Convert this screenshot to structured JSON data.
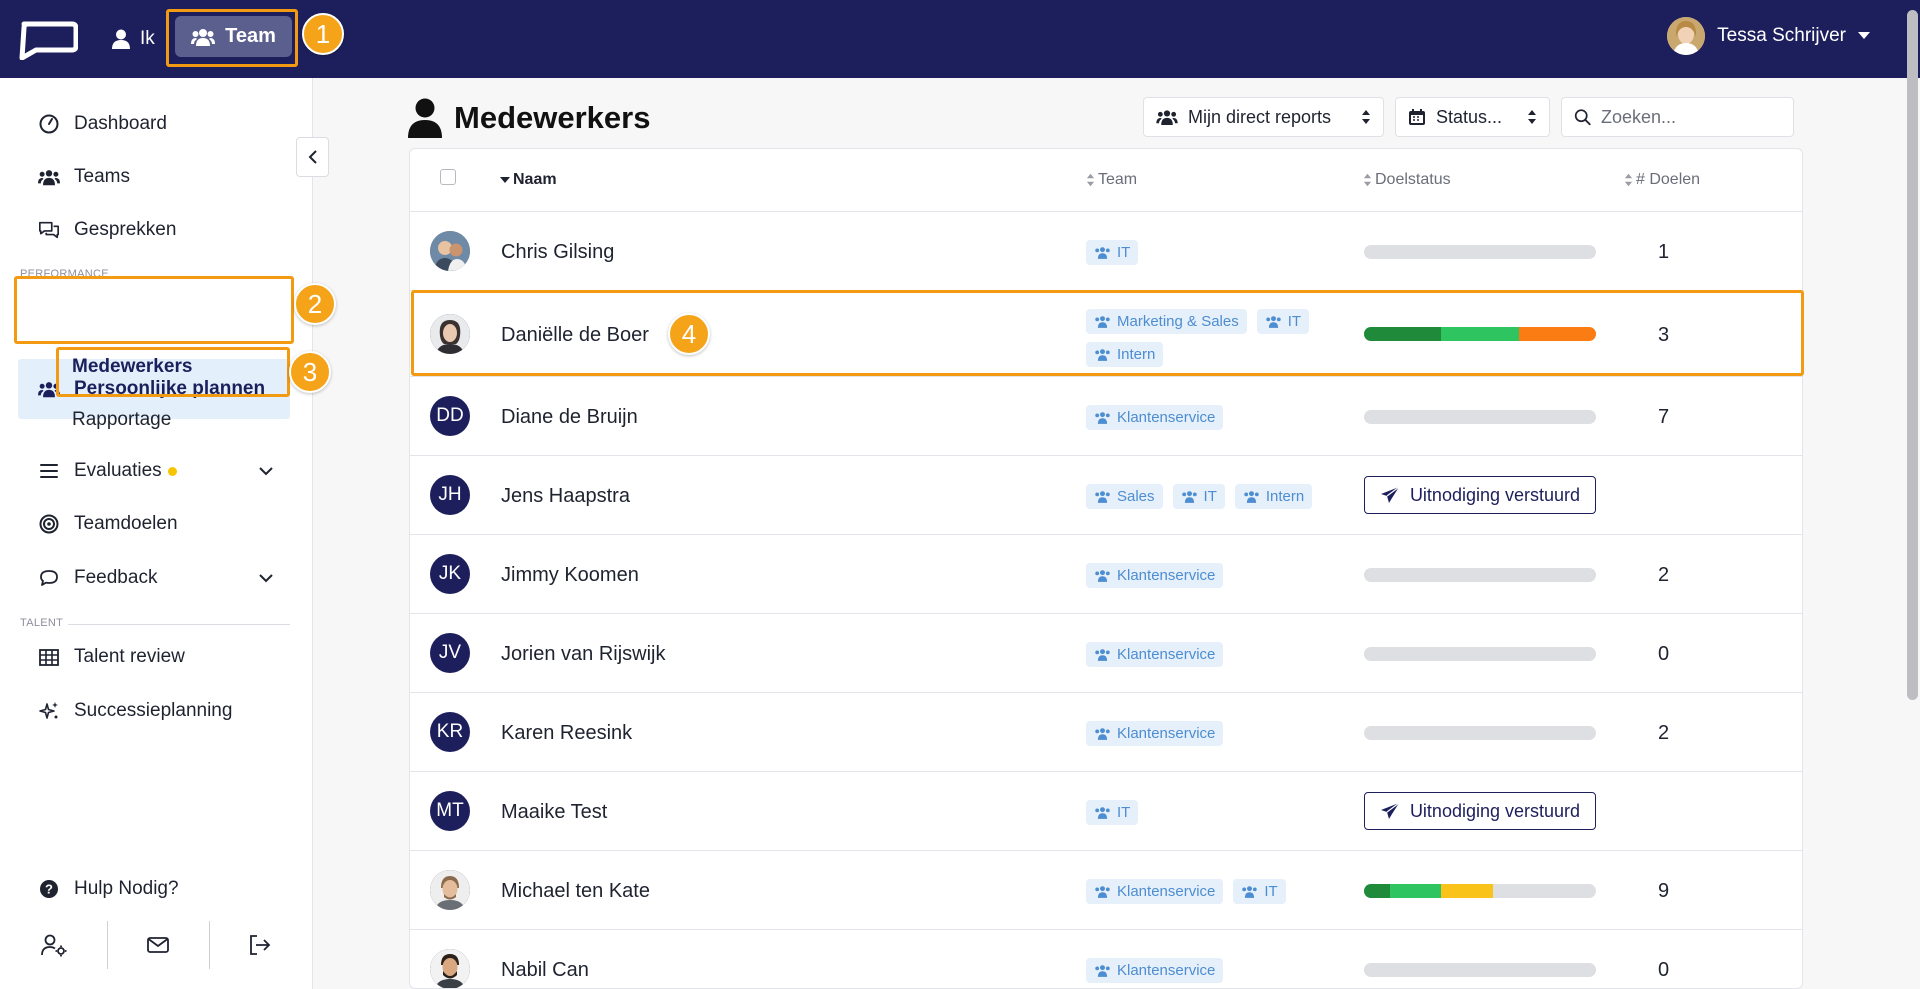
{
  "topbar": {
    "nav_ik": "Ik",
    "nav_team": "Team",
    "user_name": "Tessa Schrijver"
  },
  "sidebar": {
    "dashboard": "Dashboard",
    "teams": "Teams",
    "gesprekken": "Gesprekken",
    "section_performance": "PERFORMANCE",
    "persoonlijke_plannen": "Persoonlijke plannen",
    "sub_medewerkers": "Medewerkers",
    "sub_rapportage": "Rapportage",
    "evaluaties": "Evaluaties",
    "teamdoelen": "Teamdoelen",
    "feedback": "Feedback",
    "section_talent": "TALENT",
    "talent_review": "Talent review",
    "successieplanning": "Successieplanning",
    "hulp": "Hulp Nodig?"
  },
  "main": {
    "title": "Medewerkers",
    "filter_reports": "Mijn direct reports",
    "filter_status": "Status...",
    "search_placeholder": "Zoeken..."
  },
  "table": {
    "headers": {
      "naam": "Naam",
      "team": "Team",
      "doelstatus": "Doelstatus",
      "doelen": "# Doelen"
    },
    "rows": [
      {
        "name": "Chris Gilsing",
        "initials": "",
        "photo": true,
        "tags": [
          "IT"
        ],
        "count": "1"
      },
      {
        "name": "Daniëlle de Boer",
        "initials": "",
        "photo": true,
        "tags": [
          "Marketing & Sales",
          "IT",
          "Intern"
        ],
        "count": "3"
      },
      {
        "name": "Diane de Bruijn",
        "initials": "DD",
        "tags": [
          "Klantenservice"
        ],
        "count": "7"
      },
      {
        "name": "Jens Haapstra",
        "initials": "JH",
        "tags": [
          "Sales",
          "IT",
          "Intern"
        ],
        "invite": "Uitnodiging verstuurd",
        "count": ""
      },
      {
        "name": "Jimmy Koomen",
        "initials": "JK",
        "tags": [
          "Klantenservice"
        ],
        "count": "2"
      },
      {
        "name": "Jorien van Rijswijk",
        "initials": "JV",
        "tags": [
          "Klantenservice"
        ],
        "count": "0"
      },
      {
        "name": "Karen Reesink",
        "initials": "KR",
        "tags": [
          "Klantenservice"
        ],
        "count": "2"
      },
      {
        "name": "Maaike Test",
        "initials": "MT",
        "tags": [
          "IT"
        ],
        "invite": "Uitnodiging verstuurd",
        "count": ""
      },
      {
        "name": "Michael ten Kate",
        "initials": "",
        "photo": true,
        "tags": [
          "Klantenservice",
          "IT"
        ],
        "count": "9"
      },
      {
        "name": "Nabil Can",
        "initials": "",
        "photo": true,
        "tags": [
          "Klantenservice"
        ],
        "count": "0"
      }
    ],
    "goal_progress": {
      "Daniëlle de Boer": [
        {
          "fraction": 0.333,
          "color": "#1f8a3a"
        },
        {
          "fraction": 0.333,
          "color": "#2ec460"
        },
        {
          "fraction": 0.334,
          "color": "#fb7c13"
        }
      ],
      "Michael ten Kate": [
        {
          "fraction": 0.111,
          "color": "#1f8a3a"
        },
        {
          "fraction": 0.222,
          "color": "#2ec460"
        },
        {
          "fraction": 0.222,
          "color": "#f9c31a"
        }
      ]
    }
  },
  "annotations": [
    "1",
    "2",
    "3",
    "4"
  ],
  "colors": {
    "topbar": "#1d1f5c",
    "highlight": "#f29a11",
    "badge": "#f5a319",
    "tag_bg": "#e6f0fa",
    "tag_text": "#4d8dd1"
  }
}
